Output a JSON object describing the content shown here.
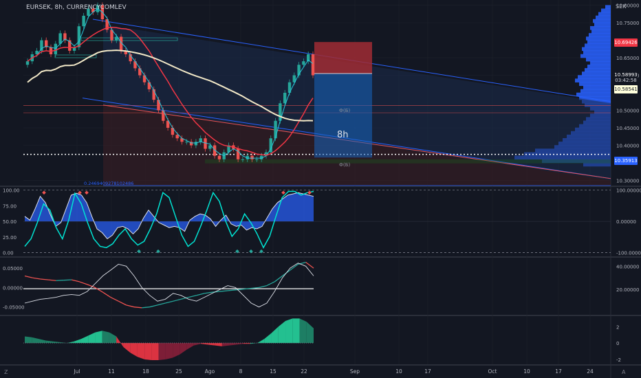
{
  "symbol": "EURSEK, 8h, CURRENCYCOMLEV",
  "currency": "SEK",
  "colors": {
    "background": "#131722",
    "up": "#26a69a",
    "down": "#ef5350",
    "grid": "#1e222d",
    "blue": "#2962ff",
    "cyan": "#00e5d4"
  },
  "price_tags": [
    {
      "text": "10.69426",
      "value": 10.694,
      "bg": "#f23645",
      "fg": "#ffffff"
    },
    {
      "text": "10.58993",
      "value": 10.601,
      "bg": "#131722",
      "fg": "#ffffff"
    },
    {
      "text": "03:42:58",
      "value": 10.585,
      "bg": "#131722",
      "fg": "#d1d4dc"
    },
    {
      "text": "10.58541",
      "value": 10.559,
      "bg": "#ffffdc",
      "fg": "#131722"
    },
    {
      "text": "10.35913",
      "value": 10.355,
      "bg": "#2962ff",
      "fg": "#ffffff"
    }
  ],
  "box_labels": {
    "top": "Ф(Б)",
    "bottom": "Ф(Б)",
    "timeframe": "8h"
  },
  "fib_label": "0.2469409278102486",
  "icons": {
    "left": "Z",
    "right": "A"
  },
  "chart_data": [
    {
      "type": "candlestick",
      "title": "EURSEK, 8h, CURRENCYCOMLEV",
      "x_labels": [
        "Jul",
        "11",
        "18",
        "25",
        "Ago",
        "8",
        "15",
        "22",
        "Sep",
        "10",
        "17",
        "Oct",
        "10",
        "17",
        "24"
      ],
      "y_ticks": [
        "10.80000",
        "10.75000",
        "10.65000",
        "10.60000",
        "10.50000",
        "10.45000",
        "10.40000",
        "10.30000"
      ],
      "y_tick_values": [
        10.8,
        10.75,
        10.65,
        10.6,
        10.5,
        10.45,
        10.4,
        10.3
      ],
      "ylim": [
        10.285,
        10.815
      ],
      "close": [
        10.64,
        10.66,
        10.67,
        10.7,
        10.68,
        10.66,
        10.69,
        10.72,
        10.7,
        10.67,
        10.68,
        10.74,
        10.77,
        10.79,
        10.78,
        10.8,
        10.76,
        10.73,
        10.7,
        10.71,
        10.67,
        10.66,
        10.64,
        10.62,
        10.6,
        10.58,
        10.56,
        10.53,
        10.5,
        10.47,
        10.45,
        10.43,
        10.42,
        10.41,
        10.41,
        10.4,
        10.41,
        10.42,
        10.39,
        10.4,
        10.37,
        10.36,
        10.38,
        10.4,
        10.39,
        10.36,
        10.36,
        10.37,
        10.36,
        10.36,
        10.37,
        10.38,
        10.42,
        10.47,
        10.52,
        10.55,
        10.58,
        10.6,
        10.63,
        10.64,
        10.66,
        10.6
      ]
    },
    {
      "type": "line",
      "y_ticks": [
        "100.00",
        "75.00",
        "50.00",
        "25.00",
        "0.00"
      ],
      "y_tick_values": [
        100,
        75,
        50,
        25,
        0
      ],
      "right_ticks": [
        "100.00000",
        "0.00000",
        "-100.00000"
      ],
      "ylim": [
        -6,
        104
      ],
      "series": [
        {
          "values": [
            58,
            52,
            70,
            90,
            80,
            60,
            42,
            48,
            70,
            92,
            95,
            92,
            80,
            58,
            38,
            32,
            22,
            28,
            40,
            42,
            38,
            30,
            38,
            55,
            68,
            58,
            48,
            44,
            40,
            42,
            40,
            34,
            52,
            58,
            62,
            60,
            54,
            42,
            52,
            60,
            46,
            42,
            44,
            36,
            40,
            38,
            42,
            56,
            70,
            80,
            86,
            92,
            94,
            96,
            94,
            92,
            90
          ]
        },
        {
          "values": [
            10,
            22,
            48,
            78,
            68,
            40,
            22,
            52,
            95,
            78,
            48,
            22,
            10,
            8,
            14,
            28,
            38,
            22,
            12,
            18,
            38,
            62,
            96,
            88,
            58,
            28,
            10,
            18,
            42,
            68,
            96,
            82,
            50,
            26,
            38,
            62,
            48,
            30,
            8,
            26,
            58,
            88,
            98,
            98,
            92,
            96,
            98
          ]
        }
      ]
    },
    {
      "type": "line",
      "y_ticks": [
        "0.05000",
        "0.00000",
        "-0.05000"
      ],
      "y_tick_values": [
        0.05,
        0.0,
        -0.05
      ],
      "right_ticks": [
        "40.00000",
        "20.00000"
      ],
      "ylim": [
        -0.07,
        0.075
      ],
      "series": [
        {
          "values": [
            0.03,
            0.025,
            0.022,
            0.02,
            0.018,
            0.019,
            0.02,
            0.015,
            0.008,
            0.0,
            -0.012,
            -0.025,
            -0.035,
            -0.045,
            -0.05,
            -0.052,
            -0.05,
            -0.045,
            -0.04,
            -0.035,
            -0.03,
            -0.025,
            -0.02,
            -0.015,
            -0.012,
            -0.01,
            -0.008,
            -0.006,
            -0.004,
            -0.002,
            0.0,
            0.005,
            0.015,
            0.03,
            0.045,
            0.06,
            0.065,
            0.05
          ]
        },
        {
          "values": [
            -0.04,
            -0.035,
            -0.03,
            -0.028,
            -0.025,
            -0.02,
            -0.018,
            -0.02,
            -0.01,
            0.01,
            0.03,
            0.045,
            0.06,
            0.055,
            0.03,
            0.0,
            -0.02,
            -0.035,
            -0.03,
            -0.015,
            -0.02,
            -0.03,
            -0.035,
            -0.025,
            -0.015,
            -0.005,
            0.005,
            0.0,
            -0.02,
            -0.04,
            -0.05,
            -0.04,
            -0.01,
            0.025,
            0.05,
            0.063,
            0.055,
            0.03
          ]
        }
      ]
    },
    {
      "type": "area",
      "y_ticks": [
        "2",
        "0",
        "-2"
      ],
      "y_tick_values": [
        2,
        0,
        -2
      ],
      "ylim": [
        -2.6,
        3.2
      ],
      "values": [
        0.8,
        0.7,
        0.5,
        0.3,
        0.2,
        0.1,
        0.0,
        0.2,
        0.5,
        0.9,
        1.3,
        1.5,
        1.3,
        0.8,
        -0.5,
        -1.2,
        -1.7,
        -2.0,
        -2.1,
        -2.1,
        -2.0,
        -1.8,
        -1.4,
        -0.8,
        -0.3,
        -0.1,
        -0.2,
        -0.3,
        -0.4,
        -0.3,
        -0.2,
        -0.1,
        -0.1,
        0.0,
        0.5,
        1.2,
        2.0,
        2.7,
        3.0,
        3.0,
        2.6,
        1.8
      ]
    }
  ]
}
